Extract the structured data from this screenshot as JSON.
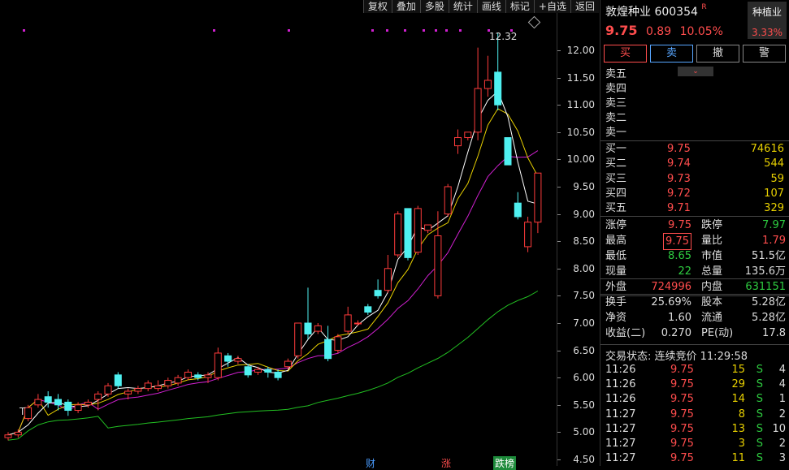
{
  "toolbar": [
    "复权",
    "叠加",
    "多股",
    "统计",
    "画线",
    "标记",
    "+自选",
    "返回"
  ],
  "y_ticks": [
    "12.00",
    "11.50",
    "11.00",
    "10.50",
    "10.00",
    "9.50",
    "9.00",
    "8.50",
    "8.00",
    "7.50",
    "7.00",
    "6.50",
    "6.00",
    "5.50",
    "5.00",
    "4.50"
  ],
  "high_label": "12.32",
  "low_marker": "T",
  "bottom_labels": [
    "财",
    "涨",
    "跌榜"
  ],
  "stock": {
    "name": "敦煌种业",
    "code": "600354",
    "flag": "R",
    "price": "9.75",
    "change": "0.89",
    "pct": "10.05%"
  },
  "sector": {
    "name": "种植业",
    "pct": "3.33%"
  },
  "actions": [
    "买",
    "卖",
    "撤",
    "警"
  ],
  "asks": [
    {
      "label": "卖五"
    },
    {
      "label": "卖四"
    },
    {
      "label": "卖三"
    },
    {
      "label": "卖二"
    },
    {
      "label": "卖一"
    }
  ],
  "bids": [
    {
      "label": "买一",
      "price": "9.75",
      "vol": "74616"
    },
    {
      "label": "买二",
      "price": "9.74",
      "vol": "544"
    },
    {
      "label": "买三",
      "price": "9.73",
      "vol": "59"
    },
    {
      "label": "买四",
      "price": "9.72",
      "vol": "107"
    },
    {
      "label": "买五",
      "price": "9.71",
      "vol": "329"
    }
  ],
  "stats": [
    {
      "l1": "涨停",
      "v1": "9.75",
      "c1": "red",
      "l2": "跌停",
      "v2": "7.97",
      "c2": "green"
    },
    {
      "l1": "最高",
      "v1": "9.75",
      "c1": "red",
      "l2": "量比",
      "v2": "1.79",
      "c2": "red"
    },
    {
      "l1": "最低",
      "v1": "8.65",
      "c1": "green",
      "l2": "市值",
      "v2": "51.5亿",
      "c2": "white"
    },
    {
      "l1": "现量",
      "v1": "22",
      "c1": "green",
      "l2": "总量",
      "v2": "135.6万",
      "c2": "white"
    },
    {
      "l1": "外盘",
      "v1": "724996",
      "c1": "red",
      "l2": "内盘",
      "v2": "631151",
      "c2": "green"
    },
    {
      "l1": "换手",
      "v1": "25.69%",
      "c1": "white",
      "l2": "股本",
      "v2": "5.28亿",
      "c2": "white"
    },
    {
      "l1": "净资",
      "v1": "1.60",
      "c1": "white",
      "l2": "流通",
      "v2": "5.28亿",
      "c2": "white"
    },
    {
      "l1": "收益(二)",
      "v1": "0.270",
      "c1": "white",
      "l2": "PE(动)",
      "v2": "17.8",
      "c2": "white"
    }
  ],
  "trade_status": "交易状态: 连续竞价 11:29:58",
  "trades": [
    {
      "time": "11:26",
      "price": "9.75",
      "vol": "15",
      "side": "S",
      "n": "4"
    },
    {
      "time": "11:26",
      "price": "9.75",
      "vol": "29",
      "side": "S",
      "n": "4"
    },
    {
      "time": "11:26",
      "price": "9.75",
      "vol": "14",
      "side": "S",
      "n": "1"
    },
    {
      "time": "11:27",
      "price": "9.75",
      "vol": "8",
      "side": "S",
      "n": "2"
    },
    {
      "time": "11:27",
      "price": "9.75",
      "vol": "13",
      "side": "S",
      "n": "10"
    },
    {
      "time": "11:27",
      "price": "9.75",
      "vol": "3",
      "side": "S",
      "n": "2"
    },
    {
      "time": "11:27",
      "price": "9.75",
      "vol": "11",
      "side": "S",
      "n": "3"
    }
  ],
  "chart_data": {
    "type": "candlestick",
    "y_range": [
      4.5,
      12.32
    ],
    "candles": [
      [
        4.9,
        4.95,
        5.0,
        4.85
      ],
      [
        4.95,
        5.0,
        5.05,
        4.9
      ],
      [
        5.25,
        5.45,
        5.5,
        5.2
      ],
      [
        5.5,
        5.6,
        5.7,
        5.45
      ],
      [
        5.65,
        5.55,
        5.75,
        5.45
      ],
      [
        5.6,
        5.5,
        5.7,
        5.4
      ],
      [
        5.55,
        5.4,
        5.6,
        5.3
      ],
      [
        5.4,
        5.5,
        5.55,
        5.35
      ],
      [
        5.5,
        5.55,
        5.6,
        5.45
      ],
      [
        5.6,
        5.7,
        5.75,
        5.4
      ],
      [
        5.7,
        5.85,
        5.9,
        5.65
      ],
      [
        6.05,
        5.85,
        6.1,
        5.8
      ],
      [
        5.7,
        5.75,
        5.8,
        5.6
      ],
      [
        5.75,
        5.8,
        5.85,
        5.7
      ],
      [
        5.8,
        5.9,
        5.95,
        5.75
      ],
      [
        5.8,
        5.85,
        5.95,
        5.75
      ],
      [
        5.85,
        5.95,
        6.0,
        5.8
      ],
      [
        5.9,
        6.0,
        6.05,
        5.85
      ],
      [
        6.0,
        6.1,
        6.15,
        5.95
      ],
      [
        6.05,
        6.0,
        6.1,
        5.95
      ],
      [
        6.0,
        6.05,
        6.1,
        5.9
      ],
      [
        6.0,
        6.45,
        6.55,
        5.95
      ],
      [
        6.4,
        6.3,
        6.45,
        6.2
      ],
      [
        6.3,
        6.35,
        6.4,
        6.25
      ],
      [
        6.2,
        6.05,
        6.25,
        6.0
      ],
      [
        6.1,
        6.15,
        6.2,
        6.05
      ],
      [
        6.15,
        6.1,
        6.2,
        6.0
      ],
      [
        6.1,
        6.0,
        6.15,
        5.95
      ],
      [
        6.2,
        6.3,
        6.35,
        6.15
      ],
      [
        6.4,
        7.0,
        7.0,
        6.35
      ],
      [
        7.0,
        6.8,
        7.65,
        6.7
      ],
      [
        6.85,
        6.95,
        7.0,
        6.8
      ],
      [
        6.7,
        6.35,
        6.95,
        6.3
      ],
      [
        6.5,
        6.75,
        6.8,
        6.45
      ],
      [
        6.85,
        7.15,
        7.3,
        6.8
      ],
      [
        7.0,
        7.0,
        7.05,
        6.95
      ],
      [
        7.3,
        7.2,
        7.35,
        7.15
      ],
      [
        7.6,
        7.5,
        7.8,
        7.45
      ],
      [
        7.6,
        8.0,
        8.25,
        7.55
      ],
      [
        8.25,
        9.0,
        9.05,
        8.2
      ],
      [
        9.1,
        8.2,
        9.1,
        8.15
      ],
      [
        8.3,
        9.1,
        9.15,
        8.25
      ],
      [
        8.7,
        8.8,
        8.75,
        8.65
      ],
      [
        7.5,
        8.6,
        9.05,
        7.45
      ],
      [
        9.0,
        9.5,
        9.55,
        8.95
      ],
      [
        10.25,
        10.4,
        10.55,
        10.1
      ],
      [
        10.4,
        10.5,
        10.45,
        10.35
      ],
      [
        10.5,
        11.3,
        12.05,
        10.35
      ],
      [
        11.3,
        11.45,
        11.9,
        11.15
      ],
      [
        11.6,
        11.0,
        12.32,
        10.9
      ],
      [
        10.4,
        9.9,
        10.4,
        9.9
      ],
      [
        9.2,
        8.95,
        9.4,
        8.9
      ],
      [
        8.4,
        8.85,
        8.95,
        8.3
      ],
      [
        8.85,
        9.75,
        9.75,
        8.65
      ]
    ]
  }
}
